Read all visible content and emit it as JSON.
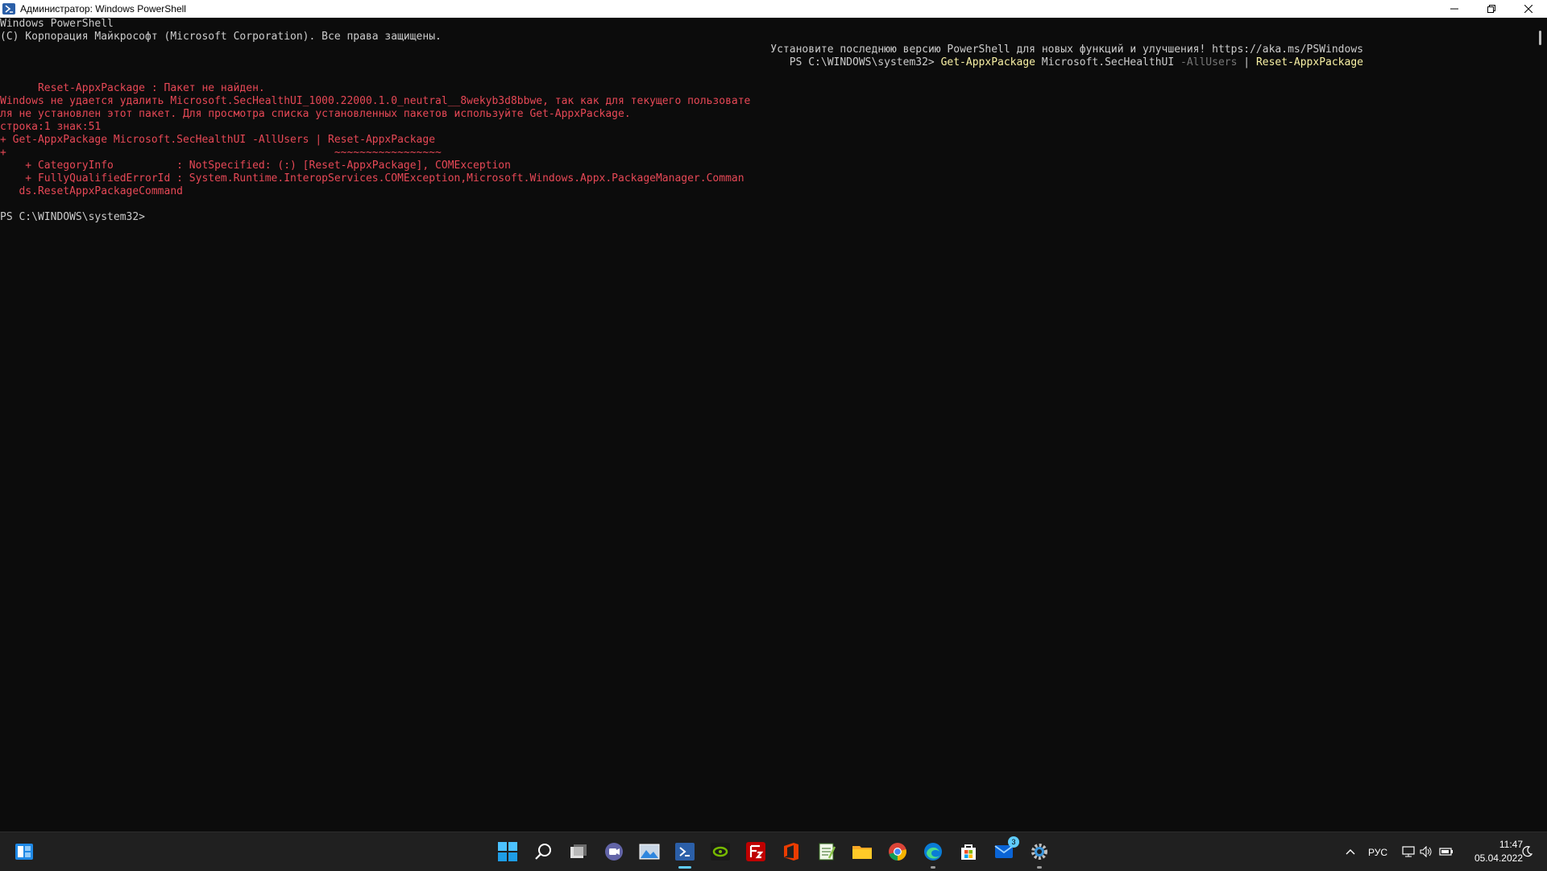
{
  "window": {
    "title": "Администратор: Windows PowerShell"
  },
  "console": {
    "banner_1": "Windows PowerShell",
    "banner_2": "(C) Корпорация Майкрософт (Microsoft Corporation). Все права защищены.",
    "update_msg": "Установите последнюю версию PowerShell для новых функций и улучшения! https://aka.ms/PSWindows",
    "prompt_1": "PS C:\\WINDOWS\\system32> ",
    "cmd_1": "Get-AppxPackage",
    "cmd_arg": " Microsoft.SecHealthUI ",
    "cmd_param": "-AllUsers",
    "cmd_pipe": " | ",
    "cmd_2": "Reset-AppxPackage",
    "error_lines": [
      "      Reset-AppxPackage : Пакет не найден.",
      "Windows не удается удалить Microsoft.SecHealthUI_1000.22000.1.0_neutral__8wekyb3d8bbwe, так как для текущего пользовате",
      "ля не установлен этот пакет. Для просмотра списка установленных пакетов используйте Get-AppxPackage.",
      "строка:1 знак:51",
      "+ Get-AppxPackage Microsoft.SecHealthUI -AllUsers | Reset-AppxPackage",
      "+                                                    ~~~~~~~~~~~~~~~~~",
      "    + CategoryInfo          : NotSpecified: (:) [Reset-AppxPackage], COMException",
      "    + FullyQualifiedErrorId : System.Runtime.InteropServices.COMException,Microsoft.Windows.Appx.PackageManager.Comman",
      "   ds.ResetAppxPackageCommand"
    ],
    "prompt_2": "PS C:\\WINDOWS\\system32>"
  },
  "taskbar": {
    "icons": [
      "start-icon",
      "search-icon",
      "task-view-icon",
      "chat-icon",
      "photos-icon",
      "powershell-icon",
      "nvidia-icon",
      "filezilla-icon",
      "office-icon",
      "notepad-icon",
      "file-explorer-icon",
      "chrome-icon",
      "edge-icon",
      "store-icon",
      "mail-icon",
      "settings-icon"
    ],
    "mail_badge": "3",
    "language": "РУС",
    "time": "11:47",
    "date": "05.04.2022"
  },
  "colors": {
    "console_bg": "#0c0c0c",
    "error": "#e74856",
    "command": "#f9f1a5",
    "parameter": "#767676",
    "taskbar_bg": "#202020",
    "accent": "#60cdff"
  }
}
